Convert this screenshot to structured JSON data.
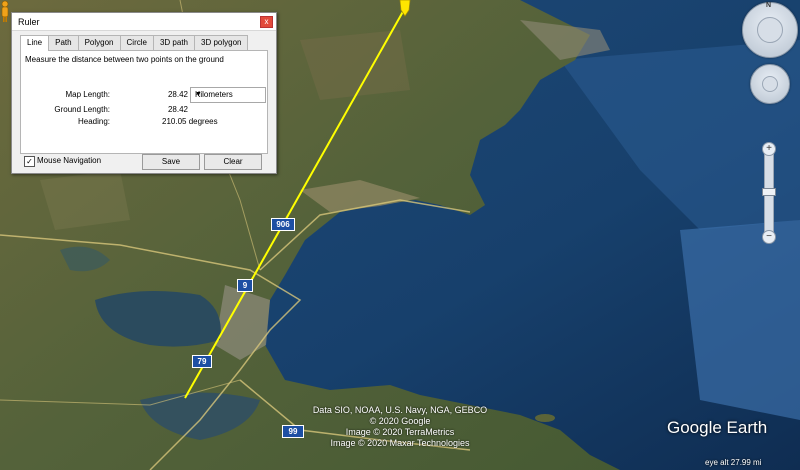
{
  "ruler": {
    "title": "Ruler",
    "close_label": "x",
    "tabs": [
      "Line",
      "Path",
      "Polygon",
      "Circle",
      "3D path",
      "3D polygon"
    ],
    "description": "Measure the distance between two points on the ground",
    "map_length_label": "Map Length:",
    "map_length_value": "28.42",
    "unit_selected": "Kilometers",
    "ground_length_label": "Ground Length:",
    "ground_length_value": "28.42",
    "heading_label": "Heading:",
    "heading_value": "210.05 degrees",
    "mouse_navigation_label": "Mouse Navigation",
    "mouse_navigation_checked": "✓",
    "save_label": "Save",
    "clear_label": "Clear"
  },
  "map": {
    "road_shields": [
      "906",
      "9",
      "79",
      "99"
    ],
    "attribution": [
      "Data SIO, NOAA, U.S. Navy, NGA, GEBCO",
      "© 2020 Google",
      "Image © 2020 TerraMetrics",
      "Image © 2020 Maxar Technologies"
    ],
    "logo": "Google Earth",
    "eye_alt": "eye alt  27.99 mi",
    "compass_north": "N",
    "zoom_in": "+",
    "zoom_out": "−",
    "colors": {
      "sea": "#0d2a4a",
      "land": "#56623a",
      "ruler_line": "#ffff00",
      "shield": "#1d4fa3"
    }
  }
}
